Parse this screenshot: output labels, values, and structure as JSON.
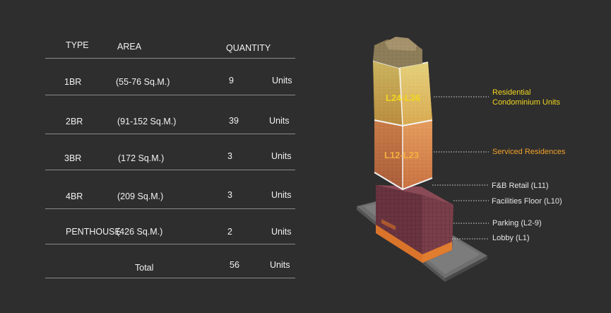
{
  "table": {
    "headers": {
      "type": "TYPE",
      "area": "AREA",
      "quantity": "QUANTITY"
    },
    "rows": [
      {
        "type": "1BR",
        "area": "(55-76 Sq.M.)",
        "qty": "9",
        "unit": "Units"
      },
      {
        "type": "2BR",
        "area": "(91-152 Sq.M.)",
        "qty": "39",
        "unit": "Units"
      },
      {
        "type": "3BR",
        "area": "(172 Sq.M.)",
        "qty": "3",
        "unit": "Units"
      },
      {
        "type": "4BR",
        "area": "(209 Sq.M.)",
        "qty": "3",
        "unit": "Units"
      },
      {
        "type": "PENTHOUSE",
        "area": "(426 Sq.M.)",
        "qty": "2",
        "unit": "Units"
      }
    ],
    "total": {
      "label": "Total",
      "qty": "56",
      "unit": "Units"
    }
  },
  "building": {
    "zone_labels": {
      "upper": "L24-L36",
      "middle": "L12-L23"
    },
    "callouts": {
      "residential_line1": "Residential",
      "residential_line2": "Condominium Units",
      "serviced": "Serviced Residences",
      "fb": "F&B Retail (L11)",
      "facilities": "Facilities Floor (L10)",
      "parking": "Parking (L2-9)",
      "lobby": "Lobby (L1)"
    }
  },
  "colors": {
    "background": "#2e2e2e",
    "residential": "#f2d51e",
    "serviced": "#f3a12a"
  }
}
